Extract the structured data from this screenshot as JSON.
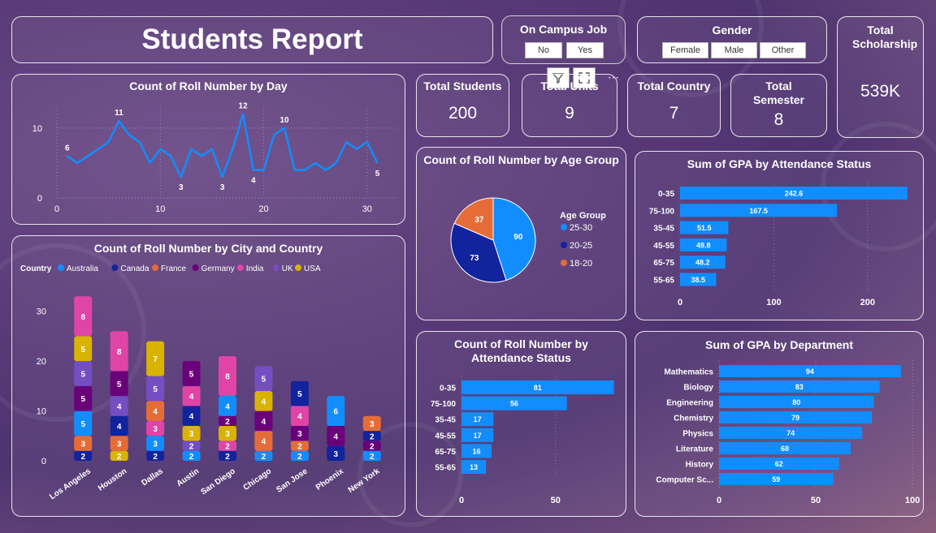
{
  "title": "Students Report",
  "slicers": {
    "campus_job": {
      "title": "On Campus Job",
      "options": [
        "No",
        "Yes"
      ]
    },
    "gender": {
      "title": "Gender",
      "options": [
        "Female",
        "Male",
        "Other"
      ]
    }
  },
  "kpis": {
    "students": {
      "label": "Total Students",
      "value": "200"
    },
    "units": {
      "label": "Total Units",
      "value": "9"
    },
    "country": {
      "label": "Total Country",
      "value": "7"
    },
    "semester": {
      "label": "Total Semester",
      "value": "8"
    },
    "scholarship": {
      "label": "Total Scholarship",
      "value": "539K"
    }
  },
  "visual_toolbar": {
    "filter_icon": "filter-icon",
    "focus_icon": "focus-mode-icon",
    "more_icon": "more-options-icon"
  },
  "colors": {
    "blue": "#118DFF",
    "navy": "#12239E",
    "orange": "#E66C37",
    "purple": "#6B007B",
    "pink": "#E044A7",
    "violet": "#744EC2",
    "gold": "#D9B300"
  },
  "chart_data": [
    {
      "id": "day",
      "type": "line",
      "title": "Count of Roll Number by Day",
      "x": [
        1,
        2,
        3,
        4,
        5,
        6,
        7,
        8,
        9,
        10,
        11,
        12,
        13,
        14,
        15,
        16,
        17,
        18,
        19,
        20,
        21,
        22,
        23,
        24,
        25,
        26,
        27,
        28,
        29,
        30,
        31
      ],
      "values": [
        6,
        5,
        6,
        7,
        8,
        11,
        9,
        8,
        5,
        7,
        6,
        3,
        7,
        6,
        7,
        3,
        7,
        12,
        4,
        4,
        9,
        10,
        4,
        4,
        5,
        4,
        5,
        8,
        7,
        8,
        5
      ],
      "data_labels": [
        {
          "x": 1,
          "label": "6"
        },
        {
          "x": 6,
          "label": "11"
        },
        {
          "x": 12,
          "label": "3"
        },
        {
          "x": 16,
          "label": "3"
        },
        {
          "x": 18,
          "label": "12"
        },
        {
          "x": 19,
          "label": "4"
        },
        {
          "x": 22,
          "label": "10"
        },
        {
          "x": 31,
          "label": "5"
        }
      ],
      "xticks": [
        "0",
        "10",
        "20",
        "30"
      ],
      "yticks": [
        "0",
        "10"
      ],
      "xlim": [
        0,
        33
      ],
      "ylim": [
        0,
        13
      ]
    },
    {
      "id": "city",
      "type": "bar",
      "title": "Count of Roll Number by City and Country",
      "legend_title": "Country",
      "countries": [
        "Australia",
        "Canada",
        "France",
        "Germany",
        "India",
        "UK",
        "USA"
      ],
      "categories": [
        "Los Angeles",
        "Houston",
        "Dallas",
        "Austin",
        "San Diego",
        "Chicago",
        "San Jose",
        "Phoenix",
        "New York"
      ],
      "stacks": [
        [
          {
            "c": 1,
            "v": 2
          },
          {
            "c": 2,
            "v": 3
          },
          {
            "c": 0,
            "v": 5
          },
          {
            "c": 3,
            "v": 5
          },
          {
            "c": 5,
            "v": 5
          },
          {
            "c": 6,
            "v": 5
          },
          {
            "c": 4,
            "v": 8
          }
        ],
        [
          {
            "c": 6,
            "v": 2
          },
          {
            "c": 2,
            "v": 3
          },
          {
            "c": 1,
            "v": 4
          },
          {
            "c": 5,
            "v": 4
          },
          {
            "c": 3,
            "v": 5
          },
          {
            "c": 4,
            "v": 8
          }
        ],
        [
          {
            "c": 1,
            "v": 2
          },
          {
            "c": 0,
            "v": 3
          },
          {
            "c": 4,
            "v": 3
          },
          {
            "c": 2,
            "v": 4
          },
          {
            "c": 5,
            "v": 5
          },
          {
            "c": 6,
            "v": 7
          }
        ],
        [
          {
            "c": 0,
            "v": 2
          },
          {
            "c": 5,
            "v": 2
          },
          {
            "c": 6,
            "v": 3
          },
          {
            "c": 1,
            "v": 4
          },
          {
            "c": 4,
            "v": 4
          },
          {
            "c": 3,
            "v": 5
          }
        ],
        [
          {
            "c": 1,
            "v": 2
          },
          {
            "c": 4,
            "v": 2
          },
          {
            "c": 6,
            "v": 3
          },
          {
            "c": 3,
            "v": 2
          },
          {
            "c": 0,
            "v": 4
          },
          {
            "c": 4,
            "v": 8
          }
        ],
        [
          {
            "c": 0,
            "v": 2
          },
          {
            "c": 2,
            "v": 4
          },
          {
            "c": 3,
            "v": 4
          },
          {
            "c": 6,
            "v": 4
          },
          {
            "c": 5,
            "v": 5
          }
        ],
        [
          {
            "c": 0,
            "v": 2
          },
          {
            "c": 2,
            "v": 2
          },
          {
            "c": 3,
            "v": 3
          },
          {
            "c": 4,
            "v": 4
          },
          {
            "c": 1,
            "v": 5
          }
        ],
        [
          {
            "c": 1,
            "v": 3
          },
          {
            "c": 3,
            "v": 4
          },
          {
            "c": 0,
            "v": 6
          }
        ],
        [
          {
            "c": 0,
            "v": 2
          },
          {
            "c": 3,
            "v": 2
          },
          {
            "c": 1,
            "v": 2
          },
          {
            "c": 2,
            "v": 3
          }
        ]
      ],
      "yticks": [
        "0",
        "10",
        "20",
        "30"
      ],
      "ylim": [
        0,
        35
      ]
    },
    {
      "id": "age",
      "type": "pie",
      "title": "Count of Roll Number by Age Group",
      "legend_title": "Age Group",
      "categories": [
        "25-30",
        "20-25",
        "18-20"
      ],
      "values": [
        90,
        73,
        37
      ]
    },
    {
      "id": "gpa_att",
      "type": "bar",
      "title": "Sum of GPA by Attendance Status",
      "categories": [
        "0-35",
        "75-100",
        "35-45",
        "45-55",
        "65-75",
        "55-65"
      ],
      "values": [
        242.6,
        167.5,
        51.5,
        49.8,
        48.2,
        38.5
      ],
      "labels": [
        "242.6",
        "167.5",
        "51.5",
        "49.8",
        "48.2",
        "38.5"
      ],
      "xticks": [
        {
          "v": 0,
          "label": "0"
        },
        {
          "v": 100,
          "label": "100"
        },
        {
          "v": 200,
          "label": "200"
        }
      ],
      "xlim": [
        0,
        260
      ]
    },
    {
      "id": "roll_att",
      "type": "bar",
      "title": "Count of Roll Number by Attendance Status",
      "categories": [
        "0-35",
        "75-100",
        "35-45",
        "45-55",
        "65-75",
        "55-65"
      ],
      "values": [
        81,
        56,
        17,
        17,
        16,
        13
      ],
      "labels": [
        "81",
        "56",
        "17",
        "17",
        "16",
        "13"
      ],
      "xticks": [
        {
          "v": 0,
          "label": "0"
        },
        {
          "v": 50,
          "label": "50"
        }
      ],
      "xlim": [
        0,
        95
      ]
    },
    {
      "id": "gpa_dept",
      "type": "bar",
      "title": "Sum of GPA by Department",
      "categories": [
        "Mathematics",
        "Biology",
        "Engineering",
        "Chemistry",
        "Physics",
        "Literature",
        "History",
        "Computer Sc..."
      ],
      "values": [
        94,
        83,
        80,
        79,
        74,
        68,
        62,
        59
      ],
      "labels": [
        "94",
        "83",
        "80",
        "79",
        "74",
        "68",
        "62",
        "59"
      ],
      "xticks": [
        {
          "v": 0,
          "label": "0"
        },
        {
          "v": 50,
          "label": "50"
        },
        {
          "v": 100,
          "label": "100"
        }
      ],
      "xlim": [
        0,
        105
      ]
    }
  ]
}
